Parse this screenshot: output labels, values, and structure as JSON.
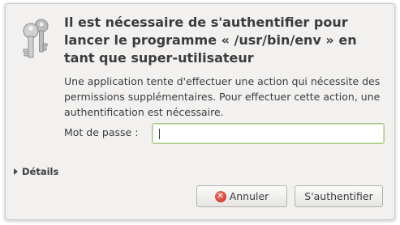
{
  "dialog": {
    "heading": "Il est nécessaire de s'authentifier pour lancer le programme « /usr/bin/env » en tant que super-utilisateur",
    "description": "Une application tente d'effectuer une action qui nécessite des permissions supplémentaires. Pour effectuer cette action, une authentification est nécessaire.",
    "icon": "keys-icon"
  },
  "password": {
    "label": "Mot de passe :",
    "value": "",
    "placeholder": ""
  },
  "details": {
    "label": "Détails",
    "icon": "expander-triangle-icon"
  },
  "buttons": {
    "cancel_label": "Annuler",
    "cancel_icon": "cancel-icon",
    "authenticate_label": "S'authentifier"
  },
  "colors": {
    "background": "#f2f1f0",
    "text": "#3c3c3c",
    "input_focus_border": "#a8c98a",
    "cancel_icon": "#c5281c"
  }
}
